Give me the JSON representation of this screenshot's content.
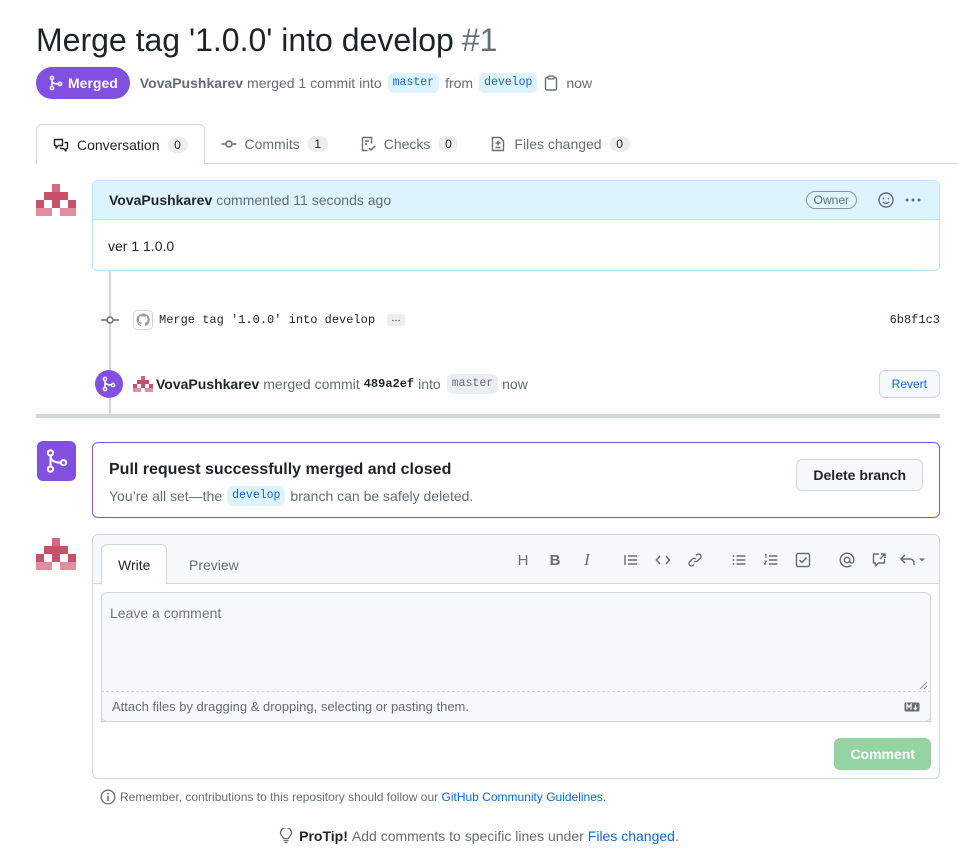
{
  "pr": {
    "title": "Merge tag '1.0.0' into develop",
    "number": "#1",
    "state": "Merged",
    "author": "VovaPushkarev",
    "merged_text": "merged 1 commit into",
    "base_branch": "master",
    "from_text": "from",
    "head_branch": "develop",
    "time": "now"
  },
  "tabs": [
    {
      "label": "Conversation",
      "count": "0",
      "icon": "comment-discussion-icon"
    },
    {
      "label": "Commits",
      "count": "1",
      "icon": "git-commit-icon"
    },
    {
      "label": "Checks",
      "count": "0",
      "icon": "checklist-icon"
    },
    {
      "label": "Files changed",
      "count": "0",
      "icon": "file-diff-icon"
    }
  ],
  "comment": {
    "author": "VovaPushkarev",
    "action": "commented 11 seconds ago",
    "badge": "Owner",
    "body": "ver 1 1.0.0"
  },
  "commit": {
    "message": "Merge tag '1.0.0' into develop",
    "ellipsis": "…",
    "sha": "6b8f1c3"
  },
  "merge_event": {
    "author": "VovaPushkarev",
    "action": "merged commit",
    "sha": "489a2ef",
    "into_text": "into",
    "branch": "master",
    "time": "now",
    "revert_label": "Revert"
  },
  "merged_box": {
    "title": "Pull request successfully merged and closed",
    "sub_before": "You’re all set—the",
    "branch": "develop",
    "sub_after": "branch can be safely deleted.",
    "delete_label": "Delete branch"
  },
  "editor": {
    "write_tab": "Write",
    "preview_tab": "Preview",
    "placeholder": "Leave a comment",
    "attach_text": "Attach files by dragging & dropping, selecting or pasting them.",
    "comment_label": "Comment",
    "toolbar": {
      "heading": "H",
      "bold": "B",
      "italic": "I"
    }
  },
  "guidelines": {
    "text": "Remember, contributions to this repository should follow our",
    "link": "GitHub Community Guidelines",
    "end": "."
  },
  "protip": {
    "label": "ProTip!",
    "text": "Add comments to specific lines under",
    "link": "Files changed",
    "end": "."
  },
  "colors": {
    "merged_purple": "#8250df",
    "link_blue": "#0969da",
    "avatar_pink": "#c8506b",
    "comment_green_disabled": "#94d3a2"
  }
}
